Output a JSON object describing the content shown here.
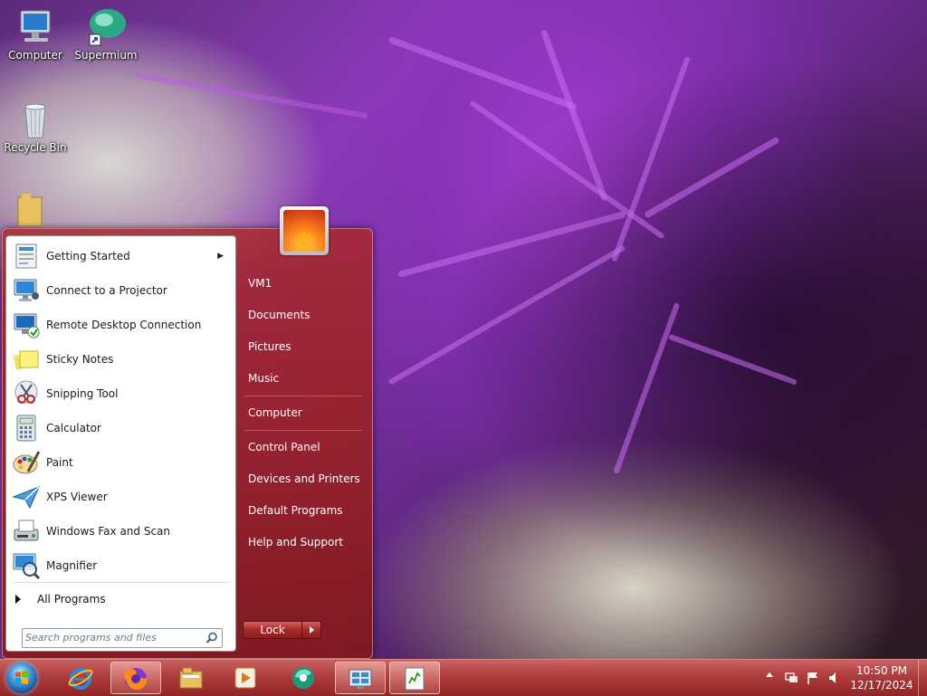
{
  "desktop": {
    "icons": [
      {
        "label": "Computer",
        "icon": "computer-icon"
      },
      {
        "label": "Supermium",
        "icon": "supermium-icon"
      },
      {
        "label": "Recycle Bin",
        "icon": "recycle-bin-icon"
      }
    ]
  },
  "start_menu": {
    "programs": [
      {
        "label": "Getting Started",
        "icon": "getting-started-icon",
        "has_submenu": true
      },
      {
        "label": "Connect to a Projector",
        "icon": "projector-icon"
      },
      {
        "label": "Remote Desktop Connection",
        "icon": "remote-desktop-icon"
      },
      {
        "label": "Sticky Notes",
        "icon": "sticky-notes-icon"
      },
      {
        "label": "Snipping Tool",
        "icon": "snipping-tool-icon"
      },
      {
        "label": "Calculator",
        "icon": "calculator-icon"
      },
      {
        "label": "Paint",
        "icon": "paint-icon"
      },
      {
        "label": "XPS Viewer",
        "icon": "xps-viewer-icon"
      },
      {
        "label": "Windows Fax and Scan",
        "icon": "fax-scan-icon"
      },
      {
        "label": "Magnifier",
        "icon": "magnifier-icon"
      }
    ],
    "all_programs_label": "All Programs",
    "search_placeholder": "Search programs and files",
    "places": [
      {
        "label": "VM1"
      },
      {
        "label": "Documents"
      },
      {
        "label": "Pictures"
      },
      {
        "label": "Music"
      },
      {
        "label": "Computer"
      },
      {
        "label": "Control Panel"
      },
      {
        "label": "Devices and Printers"
      },
      {
        "label": "Default Programs"
      },
      {
        "label": "Help and Support"
      }
    ],
    "power_button_label": "Lock"
  },
  "taskbar": {
    "pinned": [
      {
        "name": "internet-explorer",
        "icon": "internet-explorer-icon",
        "active": false
      },
      {
        "name": "firefox",
        "icon": "firefox-icon",
        "active": true
      },
      {
        "name": "file-explorer",
        "icon": "file-explorer-icon",
        "active": false
      },
      {
        "name": "media-player",
        "icon": "media-player-icon",
        "active": false
      },
      {
        "name": "supermium",
        "icon": "supermium-icon",
        "active": false
      },
      {
        "name": "remote-app",
        "icon": "remote-app-icon",
        "active": true
      },
      {
        "name": "notepad-chart",
        "icon": "task-manager-icon",
        "active": true
      }
    ],
    "clock": {
      "time": "10:50 PM",
      "date": "12/17/2024"
    }
  },
  "colors": {
    "accent": "#a82a2a",
    "start_menu_bg": "#9e2323"
  }
}
